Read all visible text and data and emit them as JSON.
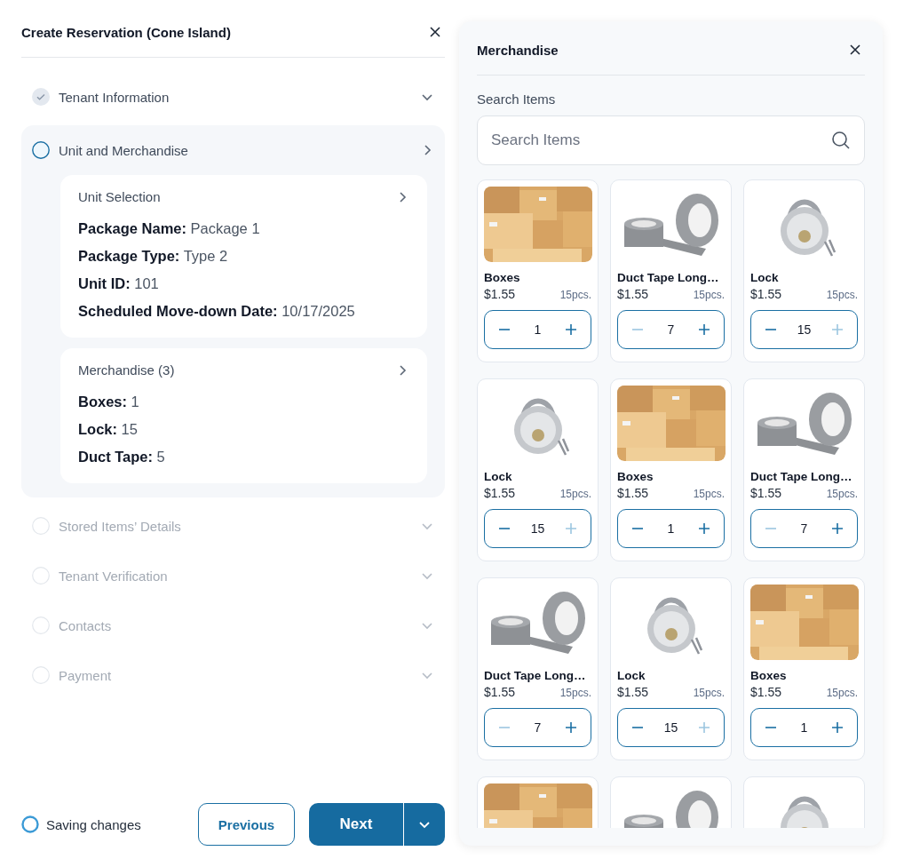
{
  "reservation": {
    "title": "Create Reservation (Cone Island)",
    "steps": [
      {
        "label": "Tenant Information",
        "completed": true,
        "disabled": false,
        "expanded": false
      },
      {
        "label": "Unit and Merchandise",
        "completed": false,
        "disabled": false,
        "expanded": true,
        "sections": [
          {
            "title": "Unit Selection",
            "lines": [
              "**Package Name:** Package 1",
              "**Package Type:** Type 2",
              "**Unit ID:** 101",
              "**Scheduled Move-down Date:** 10/17/2025"
            ]
          },
          {
            "title": "Merchandise (3)",
            "lines": [
              "**Boxes:** 1",
              "**Lock:** 15",
              "**Duct Tape:** 5"
            ]
          }
        ]
      },
      {
        "label": "Stored Items’ Details",
        "completed": false,
        "disabled": true,
        "expanded": false
      },
      {
        "label": "Tenant Verification",
        "completed": false,
        "disabled": true,
        "expanded": false
      },
      {
        "label": "Contacts",
        "completed": false,
        "disabled": true,
        "expanded": false
      },
      {
        "label": "Payment",
        "completed": false,
        "disabled": true,
        "expanded": false
      }
    ],
    "footer": {
      "status": "Saving changes",
      "previous": "Previous",
      "next": "Next"
    }
  },
  "merchandise": {
    "title": "Merchandise",
    "search_label": "Search Items",
    "search": {
      "placeholder": "Search Items"
    },
    "items": [
      {
        "kind": "boxes",
        "name": "Boxes",
        "price": "$1.55",
        "stock": "15pcs.",
        "quantity": "1",
        "minus_disabled": false,
        "plus_disabled": false
      },
      {
        "kind": "tape",
        "name": "Duct Tape Long…",
        "price": "$1.55",
        "stock": "15pcs.",
        "quantity": "7",
        "minus_disabled": true,
        "plus_disabled": false
      },
      {
        "kind": "lock",
        "name": "Lock",
        "price": "$1.55",
        "stock": "15pcs.",
        "quantity": "15",
        "minus_disabled": false,
        "plus_disabled": true
      },
      {
        "kind": "lock",
        "name": "Lock",
        "price": "$1.55",
        "stock": "15pcs.",
        "quantity": "15",
        "minus_disabled": false,
        "plus_disabled": true
      },
      {
        "kind": "boxes",
        "name": "Boxes",
        "price": "$1.55",
        "stock": "15pcs.",
        "quantity": "1",
        "minus_disabled": false,
        "plus_disabled": false
      },
      {
        "kind": "tape",
        "name": "Duct Tape Long…",
        "price": "$1.55",
        "stock": "15pcs.",
        "quantity": "7",
        "minus_disabled": true,
        "plus_disabled": false
      },
      {
        "kind": "tape",
        "name": "Duct Tape Long…",
        "price": "$1.55",
        "stock": "15pcs.",
        "quantity": "7",
        "minus_disabled": true,
        "plus_disabled": false
      },
      {
        "kind": "lock",
        "name": "Lock",
        "price": "$1.55",
        "stock": "15pcs.",
        "quantity": "15",
        "minus_disabled": false,
        "plus_disabled": true
      },
      {
        "kind": "boxes",
        "name": "Boxes",
        "price": "$1.55",
        "stock": "15pcs.",
        "quantity": "1",
        "minus_disabled": false,
        "plus_disabled": false
      },
      {
        "kind": "boxes"
      },
      {
        "kind": "tape"
      },
      {
        "kind": "lock"
      }
    ]
  }
}
